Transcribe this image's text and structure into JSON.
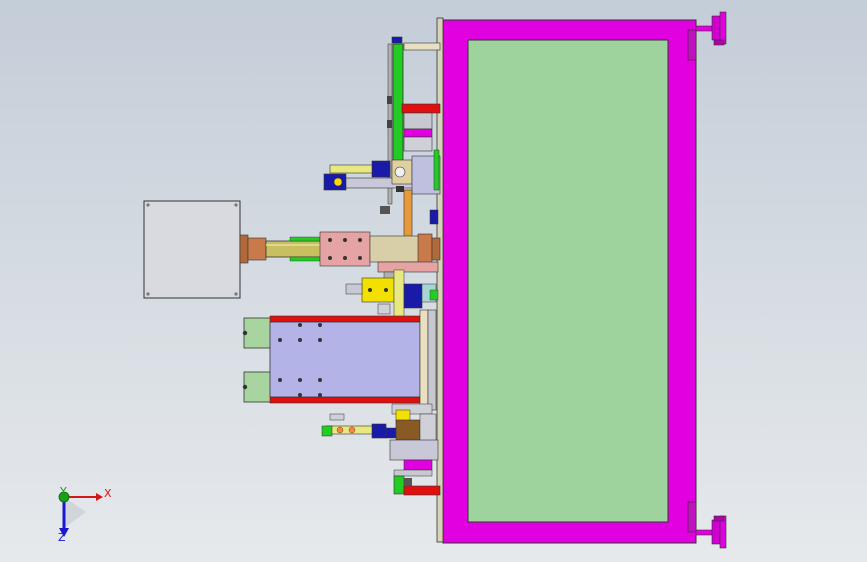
{
  "viewport": {
    "background_top": "#c4cdd8",
    "background_bottom": "#e6e9ec"
  },
  "colors": {
    "frame_magenta": "#e000e0",
    "panel_green": "#9ed39e",
    "rail_green": "#22cc22",
    "red_part": "#e01010",
    "blue_part": "#1a1aa8",
    "yellow_part": "#f2e000",
    "orange_part": "#e89a3a",
    "copper_part": "#c87a4a",
    "tube_olive": "#c8c060",
    "lavender_plate": "#b3b3e8",
    "pale_green_block": "#a8d4a0",
    "grey_plate": "#d9d9e0",
    "tan_part": "#d8cfa8",
    "pink_part": "#e6a3a3",
    "brown_part": "#8a5a24"
  },
  "triad": {
    "x_label": "X",
    "y_label": "Y",
    "z_label": "Z",
    "x_color": "#d01818",
    "y_color": "#18a018",
    "z_color": "#1818d0"
  }
}
